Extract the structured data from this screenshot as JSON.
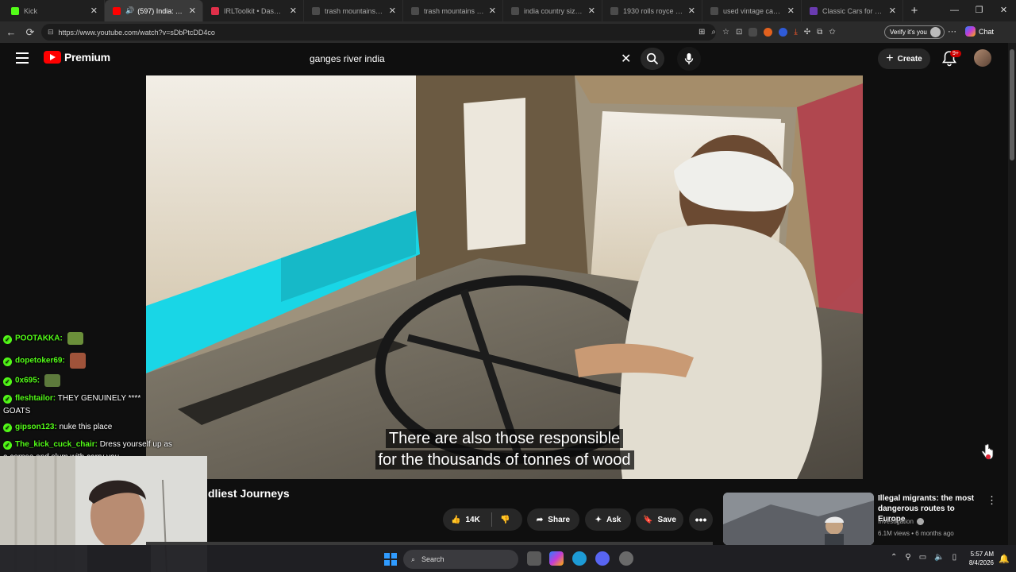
{
  "browser": {
    "tabs": [
      {
        "title": "Kick",
        "favicon_color": "#53fc18",
        "active": false
      },
      {
        "title": "(597) India: All Roads",
        "favicon_color": "#ff0000",
        "active": true,
        "audio_icon": "speaker-icon"
      },
      {
        "title": "IRLToolkit • Dashboard",
        "favicon_color": "#e0304a",
        "active": false
      },
      {
        "title": "trash mountains in the u",
        "favicon_color": "#4b4b4b",
        "active": false
      },
      {
        "title": "trash mountains in the u",
        "favicon_color": "#4b4b4b",
        "active": false
      },
      {
        "title": "india country size comp",
        "favicon_color": "#4b4b4b",
        "active": false
      },
      {
        "title": "1930 rolls royce used an",
        "favicon_color": "#4b4b4b",
        "active": false
      },
      {
        "title": "used vintage cars for sa",
        "favicon_color": "#4b4b4b",
        "active": false
      },
      {
        "title": "Classic Cars for Sale Ne",
        "favicon_color": "#6a3bb0",
        "active": false
      }
    ],
    "new_tab_symbol": "+",
    "url": "https://www.youtube.com/watch?v=sDbPtcDD4co",
    "verify_label": "Verify it's you",
    "copilot_label": "Chat"
  },
  "youtube": {
    "logo_text": "Premium",
    "search_value": "ganges river india",
    "create_label": "Create",
    "notification_badge": "9+",
    "subtitle_line1": "There are also those responsible",
    "subtitle_line2": "for the thousands of tonnes of wood",
    "video_title_partial": "dliest Journeys",
    "actions": {
      "likes": "14K",
      "share": "Share",
      "ask": "Ask",
      "save": "Save"
    },
    "recommended": {
      "title": "Illegal migrants: the most dangerous routes to Europe",
      "channel": "Investigation",
      "meta": "6.1M views • 6 months ago"
    }
  },
  "chat": {
    "messages": [
      {
        "user": "POOTAKKA:",
        "text": "",
        "emote_color": "#6b8f3a"
      },
      {
        "user": "dopetoker69:",
        "text": "",
        "emote_color": "#a0533a"
      },
      {
        "user": "0x695:",
        "text": "",
        "emote_color": "#5d7a3c"
      },
      {
        "user": "fleshtailor:",
        "text": "THEY GENUINELY **** GOATS"
      },
      {
        "user": "gipson123:",
        "text": "nuke this place"
      },
      {
        "user": "The_kick_cuck_chair:",
        "text": "Dress yourself up as a corpse and slum with carry you"
      }
    ]
  },
  "taskbar": {
    "search_label": "Search",
    "time": "5:57 AM",
    "date": "8/4/2026"
  }
}
